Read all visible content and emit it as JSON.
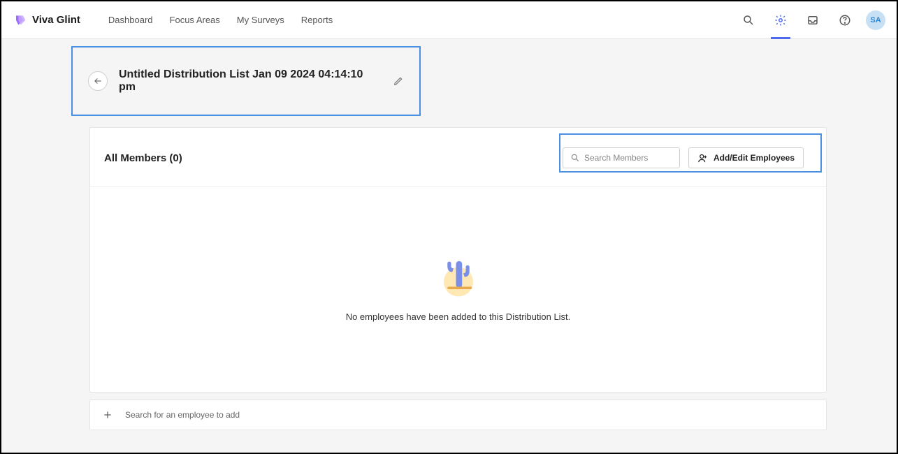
{
  "brand": {
    "name": "Viva Glint"
  },
  "nav": {
    "items": [
      "Dashboard",
      "Focus Areas",
      "My Surveys",
      "Reports"
    ]
  },
  "avatar": {
    "initials": "SA"
  },
  "page": {
    "title": "Untitled Distribution List Jan 09 2024 04:14:10 pm"
  },
  "members": {
    "heading": "All Members (0)",
    "search_placeholder": "Search Members",
    "add_edit_label": "Add/Edit Employees",
    "empty_message": "No employees have been added to this Distribution List."
  },
  "footer": {
    "hint": "Search for an employee to add"
  }
}
